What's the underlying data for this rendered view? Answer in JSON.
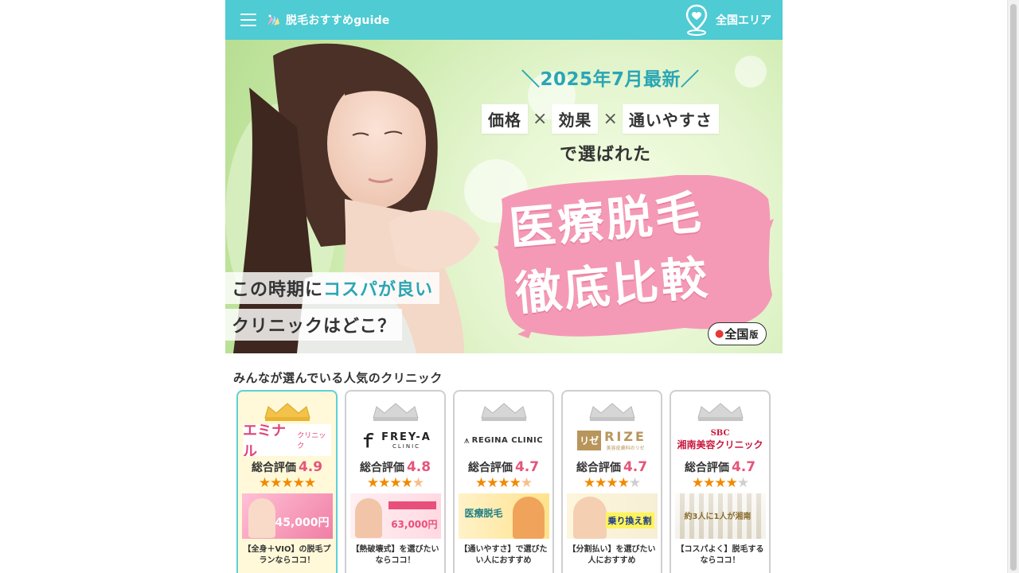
{
  "header": {
    "site_name": "脱毛おすすめguide",
    "area_label": "全国エリア"
  },
  "hero": {
    "headline": "＼2025年7月最新／",
    "keywords": [
      "価格",
      "効果",
      "通いやすさ"
    ],
    "times_symbol": "×",
    "selected_text": "で選ばれた",
    "title_line1": "医療脱毛",
    "title_line2": "徹底比較",
    "tag1_prefix": "この時期に",
    "tag1_highlight": "コスパが良い",
    "tag2": "クリニックはどこ？",
    "nation_label": "全国",
    "nation_suffix": "版"
  },
  "section_title": "みんなが選んでいる人気のクリニック",
  "score_label": "総合評価",
  "cards": [
    {
      "logo": "エミナル",
      "logo_sub": "クリニック",
      "score": "4.9",
      "rating": 5.0,
      "banner_text": "45,000円",
      "desc": "【全身＋VIO】の脱毛プランならココ！",
      "logo_color": "#e0457b"
    },
    {
      "logo": "FREY-A",
      "logo_sub": "CLINIC",
      "score": "4.8",
      "rating": 4.5,
      "banner_text": "63,000円",
      "desc": "【熱破壊式】を選びたいならココ！",
      "logo_color": "#222222"
    },
    {
      "logo": "REGINA CLINIC",
      "logo_sub": "",
      "score": "4.7",
      "rating": 4.5,
      "banner_text": "医療脱毛",
      "desc": "【通いやすさ】で選びたい人におすすめ",
      "logo_color": "#333333"
    },
    {
      "logo": "RIZE",
      "logo_sub": "美容皮膚科のリゼ",
      "score": "4.7",
      "rating": 4.5,
      "banner_text": "乗り換え割",
      "desc": "【分割払い】を選びたい人におすすめ",
      "logo_color": "#b8955a"
    },
    {
      "logo": "湘南美容クリニック",
      "logo_sub": "SBC",
      "score": "4.7",
      "rating": 4.5,
      "banner_text": "約3人に1人が湘南",
      "desc": "【コスパよく】脱毛するならココ！",
      "logo_color": "#c8173e"
    }
  ],
  "colors": {
    "header_bg": "#4ecbd3",
    "accent_teal": "#2aa6b5",
    "score_pink": "#e4567a",
    "star_orange": "#f08a00"
  }
}
